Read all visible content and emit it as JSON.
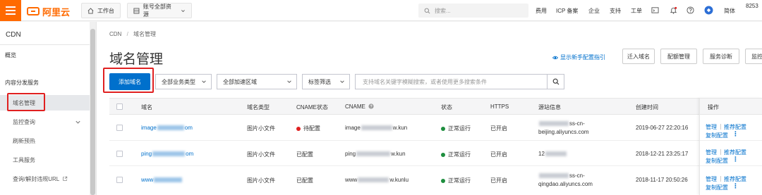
{
  "brand": {
    "name": "阿里云",
    "color": "#ff6a00"
  },
  "topbar": {
    "workbench": "工作台",
    "resource_scope": "账号全部资源",
    "search_placeholder": "搜索...",
    "links": [
      "费用",
      "ICP 备案",
      "企业",
      "支持",
      "工单"
    ],
    "language": "简体",
    "account": "8253"
  },
  "sidebar": {
    "title": "CDN",
    "items": [
      {
        "label": "概览",
        "type": "top"
      },
      {
        "label": "内容分发服务",
        "type": "group"
      },
      {
        "label": "域名管理",
        "type": "sub",
        "active": true
      },
      {
        "label": "监控查询",
        "type": "sub",
        "expandable": true
      },
      {
        "label": "刷新预热",
        "type": "sub"
      },
      {
        "label": "工具服务",
        "type": "sub"
      },
      {
        "label": "查询/解封违规URL",
        "type": "sub",
        "external": true
      }
    ]
  },
  "main": {
    "breadcrumb": [
      "CDN",
      "域名管理"
    ],
    "title": "域名管理",
    "tip_link": "显示新手配置指引",
    "header_buttons": [
      "迁入域名",
      "配额管理",
      "服务诊断",
      "监控"
    ],
    "add_button": "添加域名",
    "filters": {
      "business_type": "全部业务类型",
      "region": "全部加速区域",
      "tag": "标签筛选",
      "search_placeholder": "支持域名关键字模糊搜索，或者使用更多搜索条件"
    },
    "table": {
      "columns": [
        "域名",
        "域名类型",
        "CNAME状态",
        "CNAME",
        "状态",
        "HTTPS",
        "源站信息",
        "创建时间",
        "操作"
      ],
      "rows": [
        {
          "domain_prefix": "image",
          "domain_suffix": "om",
          "type": "图片小文件",
          "cname_status": "待配置",
          "cname_prefix": "image",
          "cname_suffix": "w.kun",
          "status": "正常运行",
          "https": "已开启",
          "origin_line1_suffix": "ss-cn-",
          "origin_line2": "beijing.aliyuncs.com",
          "created": "2019-06-27 22:20:16",
          "actions": [
            "管理",
            "推荐配置",
            "复制配置"
          ]
        },
        {
          "domain_prefix": "ping",
          "domain_suffix": "om",
          "type": "图片小文件",
          "cname_status": "已配置",
          "cname_prefix": "ping",
          "cname_suffix": "w.kun",
          "status": "正常运行",
          "https": "已开启",
          "origin_line1_suffix": "12",
          "origin_line2": "",
          "created": "2018-12-21 23:25:17",
          "actions": [
            "管理",
            "推荐配置",
            "复制配置"
          ]
        },
        {
          "domain_prefix": "www",
          "domain_suffix": "",
          "type": "图片小文件",
          "cname_status": "已配置",
          "cname_prefix": "www",
          "cname_suffix": "w.kunlu",
          "status": "正常运行",
          "https": "已开启",
          "origin_line1_suffix": "ss-cn-",
          "origin_line2": "qingdao.aliyuncs.com",
          "created": "2018-11-17 20:50:26",
          "actions": [
            "管理",
            "推荐配置",
            "复制配置"
          ]
        }
      ]
    }
  },
  "colors": {
    "primary": "#0070cc",
    "success": "#1e8e3e",
    "warning": "#e02020",
    "highlight": "#e02020"
  }
}
